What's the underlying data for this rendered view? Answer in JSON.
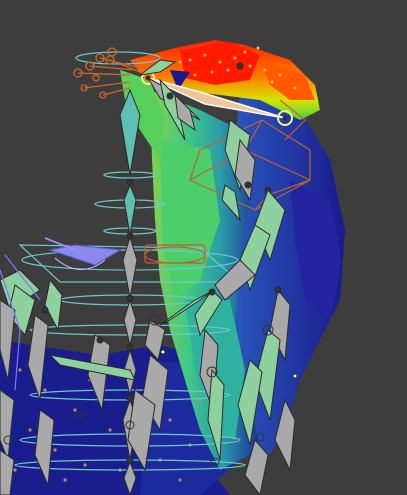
{
  "viewport": {
    "background": "#3d3d3d",
    "mode": "weight-paint",
    "overlay": "armature-bones"
  },
  "colors": {
    "bone_fill": "#a9a9a9",
    "bone_green": "#8fd19e",
    "bone_selected": "#f4f08a",
    "custom_shape": "#6ec8c8",
    "ik_controls": "#c06030",
    "weight_high": "#ff2a00",
    "weight_mid": "#32d232",
    "weight_low": "#1a1a8c",
    "pole_target": "#9090ff"
  }
}
